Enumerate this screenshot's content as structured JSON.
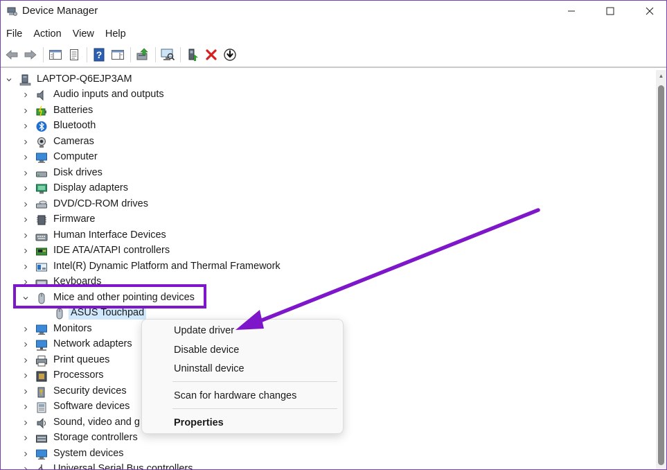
{
  "window": {
    "title": "Device Manager",
    "controls": {
      "minimize": "—",
      "maximize": "☐",
      "close": "✕"
    }
  },
  "menu": [
    "File",
    "Action",
    "View",
    "Help"
  ],
  "toolbar": {
    "icons": [
      "back-icon",
      "forward-icon",
      "show-hide-console-tree-icon",
      "properties-icon",
      "help-icon",
      "action-pane-icon",
      "update-driver-icon",
      "scan-hardware-icon",
      "enable-device-icon",
      "uninstall-device-icon",
      "download-icon"
    ]
  },
  "tree": {
    "root": {
      "label": "LAPTOP-Q6EJP3AM",
      "expanded": true
    },
    "categories": [
      {
        "label": "Audio inputs and outputs",
        "icon": "speaker-icon"
      },
      {
        "label": "Batteries",
        "icon": "battery-icon"
      },
      {
        "label": "Bluetooth",
        "icon": "bluetooth-icon"
      },
      {
        "label": "Cameras",
        "icon": "camera-icon"
      },
      {
        "label": "Computer",
        "icon": "computer-icon"
      },
      {
        "label": "Disk drives",
        "icon": "disk-drive-icon"
      },
      {
        "label": "Display adapters",
        "icon": "display-adapter-icon"
      },
      {
        "label": "DVD/CD-ROM drives",
        "icon": "dvd-drive-icon"
      },
      {
        "label": "Firmware",
        "icon": "firmware-icon"
      },
      {
        "label": "Human Interface Devices",
        "icon": "hid-icon"
      },
      {
        "label": "IDE ATA/ATAPI controllers",
        "icon": "ide-controller-icon"
      },
      {
        "label": "Intel(R) Dynamic Platform and Thermal Framework",
        "icon": "intel-framework-icon"
      },
      {
        "label": "Keyboards",
        "icon": "keyboard-icon"
      },
      {
        "label": "Mice and other pointing devices",
        "icon": "mouse-icon",
        "expanded": true
      },
      {
        "label": "Monitors",
        "icon": "monitor-icon"
      },
      {
        "label": "Network adapters",
        "icon": "network-adapter-icon"
      },
      {
        "label": "Print queues",
        "icon": "printer-icon"
      },
      {
        "label": "Processors",
        "icon": "processor-icon"
      },
      {
        "label": "Security devices",
        "icon": "security-device-icon"
      },
      {
        "label": "Software devices",
        "icon": "software-device-icon"
      },
      {
        "label": "Sound, video and g",
        "icon": "sound-icon"
      },
      {
        "label": "Storage controllers",
        "icon": "storage-controller-icon"
      },
      {
        "label": "System devices",
        "icon": "system-device-icon"
      },
      {
        "label": "Universal Serial Bus controllers",
        "icon": "usb-icon"
      }
    ],
    "selected_child": {
      "label": "ASUS Touchpad",
      "icon": "mouse-icon"
    }
  },
  "context_menu": {
    "items": [
      {
        "label": "Update driver",
        "bold": false
      },
      {
        "label": "Disable device",
        "bold": false
      },
      {
        "label": "Uninstall device",
        "bold": false
      },
      {
        "label": "Scan for hardware changes",
        "bold": false
      },
      {
        "label": "Properties",
        "bold": true
      }
    ]
  },
  "colors": {
    "annotation_purple": "#7e16c9",
    "selection_blue": "#cfe8fc",
    "window_border": "#7a3fb0"
  }
}
